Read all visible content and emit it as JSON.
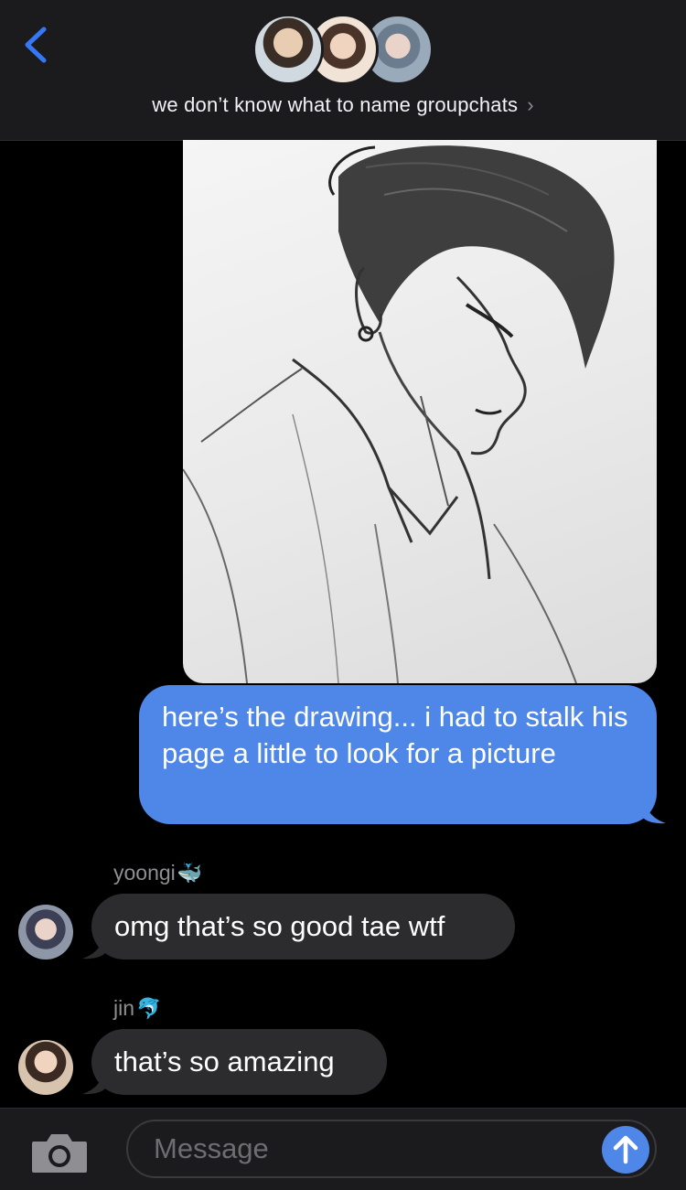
{
  "header": {
    "back_icon": "chevron-left-icon",
    "group_name": "we don’t know what to name groupchats",
    "chevron": "›"
  },
  "attachment": {
    "type": "pencil-sketch-portrait"
  },
  "messages": [
    {
      "direction": "sent",
      "text": "here’s the drawing... i had to stalk his page a little to look for a picture"
    },
    {
      "direction": "received",
      "sender": "yoongi",
      "sender_emoji": "🐳",
      "text": "omg that’s so good tae wtf"
    },
    {
      "direction": "received",
      "sender": "jin",
      "sender_emoji": "🐬",
      "text": "that’s so amazing"
    }
  ],
  "composer": {
    "placeholder": "Message",
    "camera_icon": "camera-icon",
    "send_icon": "arrow-up-icon"
  },
  "colors": {
    "sent_bubble": "#4f87e8",
    "received_bubble": "#2c2c2e",
    "accent": "#3478f6"
  }
}
